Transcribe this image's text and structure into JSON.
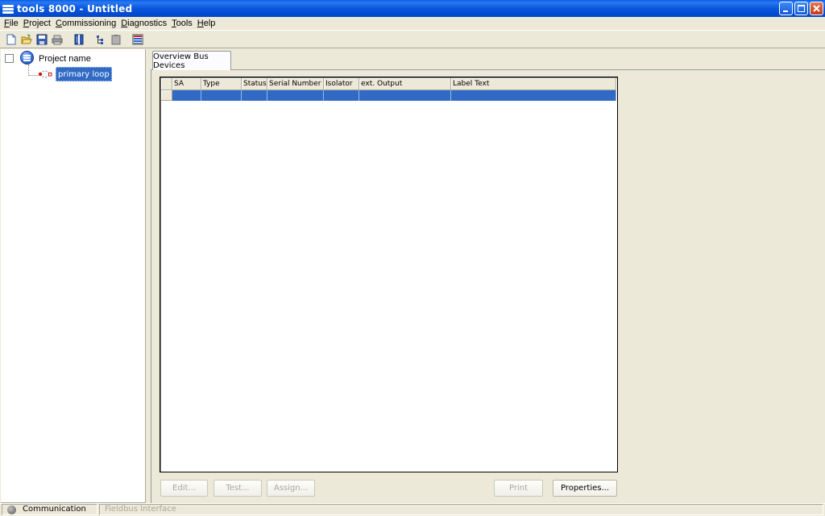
{
  "window": {
    "title": "tools 8000 - Untitled"
  },
  "menu": {
    "items": [
      "File",
      "Project",
      "Commissioning",
      "Diagnostics",
      "Tools",
      "Help"
    ]
  },
  "toolbar": {
    "icons": [
      "new-file-icon",
      "open-folder-icon",
      "save-icon",
      "print-icon",
      "book-icon",
      "tree-icon",
      "paste-icon",
      "list-icon"
    ]
  },
  "tree": {
    "project_label": "Project name",
    "loop_label": "primary loop"
  },
  "tab": {
    "label": "Overview Bus Devices"
  },
  "grid": {
    "columns": [
      "SA",
      "Type",
      "Status",
      "Serial Number",
      "Isolator",
      "ext. Output",
      "Label Text"
    ]
  },
  "buttons": {
    "edit": "Edit...",
    "test": "Test...",
    "assign": "Assign...",
    "print": "Print",
    "properties": "Properties..."
  },
  "status": {
    "communication": "Communication",
    "fieldbus": "Fieldbus Interface"
  },
  "colors": {
    "titlebar": "#0857dc",
    "selection": "#316ac5",
    "face": "#ece9d8"
  }
}
